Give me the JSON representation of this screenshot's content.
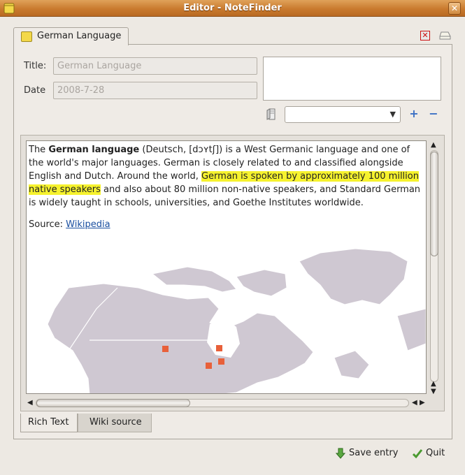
{
  "window": {
    "title": "Editor - NoteFinder"
  },
  "tab": {
    "label": "German Language"
  },
  "form": {
    "title_label": "Title:",
    "title_value": "German Language",
    "date_label": "Date",
    "date_value": "2008-7-28"
  },
  "tags": {
    "selected": ""
  },
  "content": {
    "p1_a": "The ",
    "p1_bold": "German language",
    "p1_b": " (Deutsch, [dɔʏtʃ]) is a West Germanic language and one of the world's major languages. German is closely related to and classified alongside English and Dutch. Around the world, ",
    "p1_highlight": "German is spoken by approximately 100 million native speakers",
    "p1_c": " and also about 80 million non-native speakers, and Standard German is widely taught in schools, universities, and Goethe Institutes worldwide.",
    "source_label": "Source: ",
    "source_link": "Wikipedia"
  },
  "map": {
    "marker_color": "#e8603a",
    "land_color": "#cfc8d2"
  },
  "bottom_tabs": [
    {
      "label": "Rich Text"
    },
    {
      "label": "Wiki source"
    }
  ],
  "actions": {
    "save": "Save entry",
    "quit": "Quit"
  },
  "icons": {
    "app": "notepad-icon",
    "delete": "delete-icon",
    "tag": "tag-icon",
    "save": "save-arrow-icon",
    "quit": "checkmark-icon"
  }
}
